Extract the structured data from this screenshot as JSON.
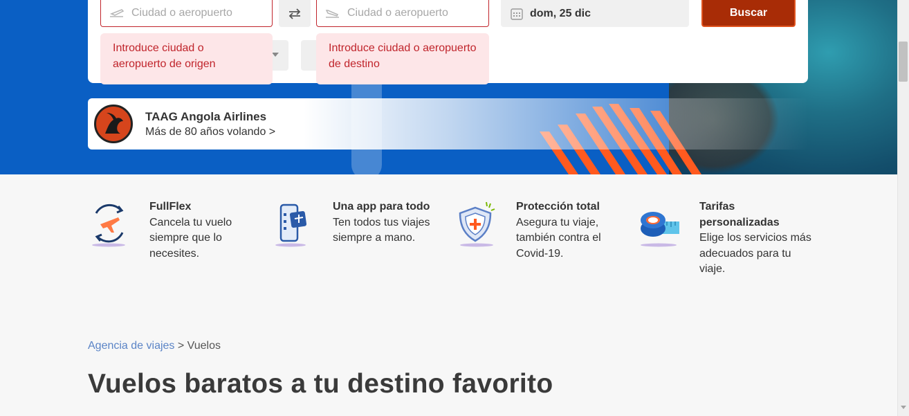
{
  "search": {
    "origin_placeholder": "Ciudad o aeropuerto",
    "destination_placeholder": "Ciudad o aeropuerto",
    "date_value": "dom, 25 dic",
    "search_button": "Buscar",
    "origin_error": "Introduce ciudad o aeropuerto de origen",
    "destination_error": "Introduce ciudad o aeropuerto de destino",
    "swap_icon": "swap-arrows-icon",
    "origin_icon": "plane-takeoff-icon",
    "destination_icon": "plane-landing-icon",
    "date_icon": "calendar-icon"
  },
  "promo": {
    "title": "TAAG Angola Airlines",
    "subtitle": "Más de 80 años volando >",
    "logo_icon": "taag-antelope-logo"
  },
  "features": [
    {
      "title": "FullFlex",
      "text": "Cancela tu vuelo siempre que lo necesites.",
      "icon": "flexible-flight-icon"
    },
    {
      "title": "Una app para todo",
      "text": "Ten todos tus viajes siempre a mano.",
      "icon": "mobile-app-icon"
    },
    {
      "title": "Protección total",
      "text": "Asegura tu viaje, también contra el Covid-19.",
      "icon": "shield-protection-icon"
    },
    {
      "title": "Tarifas personalizadas",
      "text": "Elige los servicios más adecuados para tu viaje.",
      "icon": "measuring-tape-icon"
    }
  ],
  "breadcrumb": {
    "link": "Agencia de viajes",
    "separator": ">",
    "current": "Vuelos"
  },
  "heading": "Vuelos baratos a tu destino favorito",
  "colors": {
    "hero_blue": "#0a5fc4",
    "search_button": "#a82c06",
    "error_text": "#c0242b",
    "error_bg": "#fde6e8",
    "accent_orange": "#ff5a1f"
  }
}
